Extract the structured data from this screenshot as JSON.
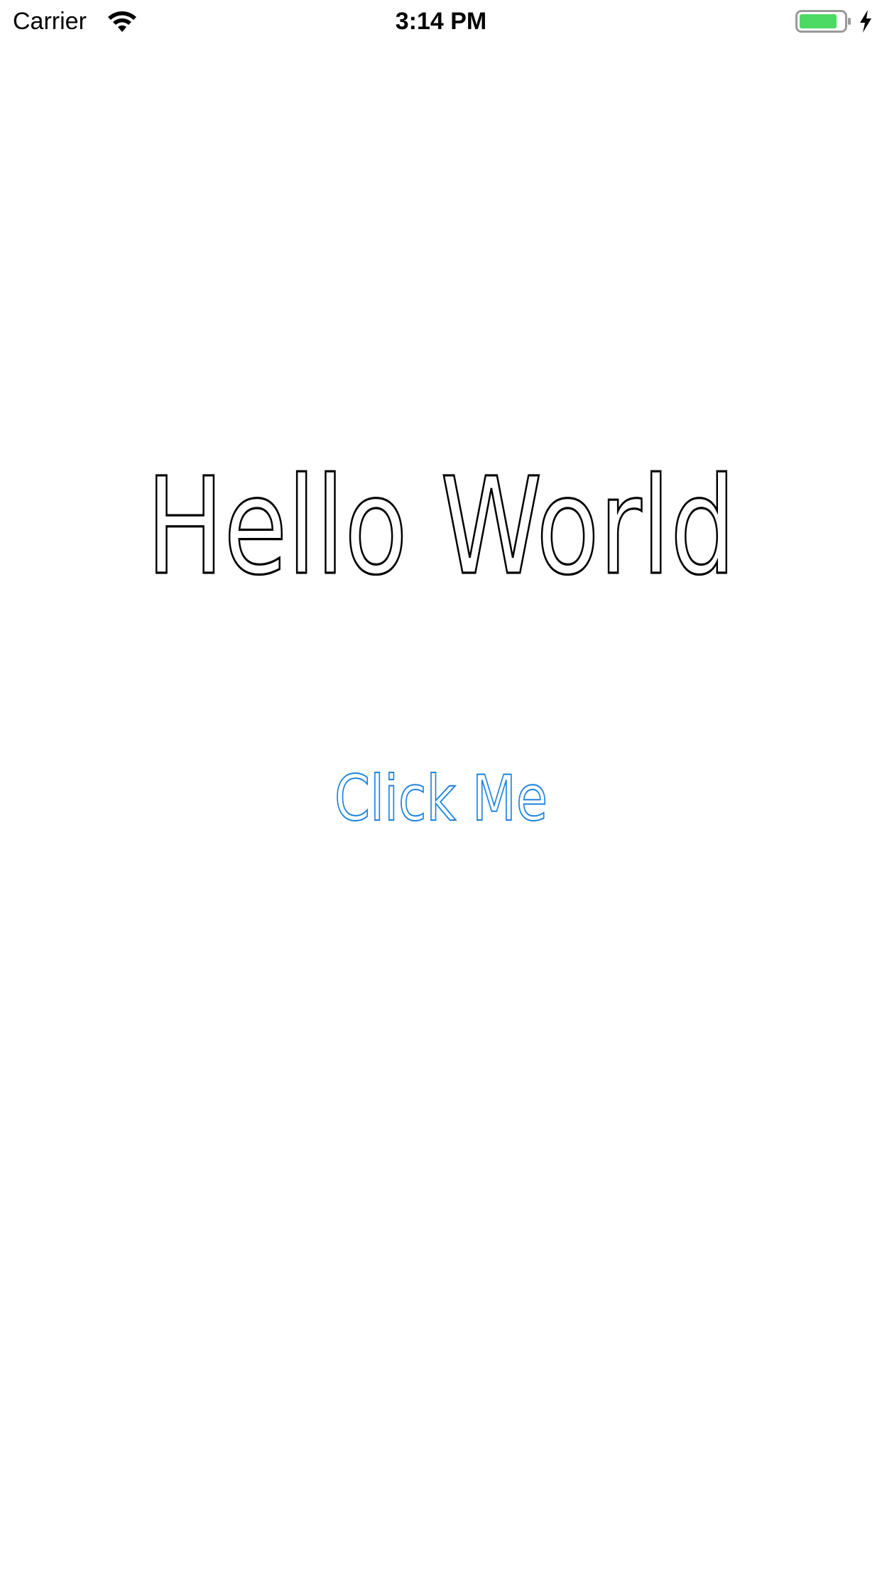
{
  "status_bar": {
    "carrier": "Carrier",
    "time": "3:14 PM",
    "wifi_icon": "wifi-icon",
    "battery_icon": "battery-icon",
    "charging_icon": "charging-bolt-icon",
    "battery_color": "#4cd964"
  },
  "main": {
    "title": "Hello World",
    "button_label": "Click Me",
    "button_color": "#1a82e2",
    "text_color": "#000000"
  }
}
